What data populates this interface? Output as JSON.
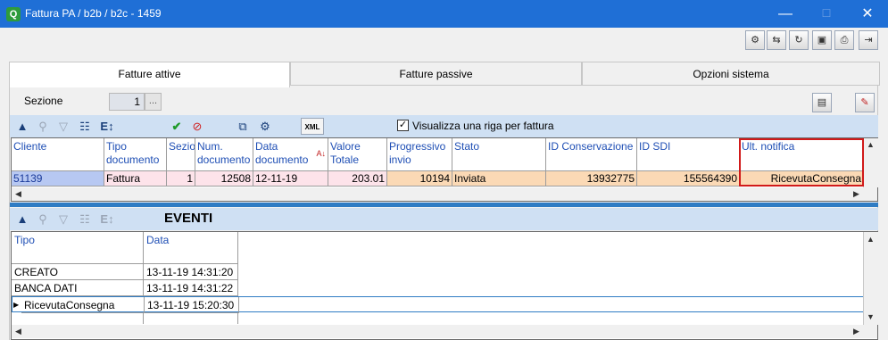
{
  "window": {
    "title": "Fattura PA / b2b / b2c - 1459",
    "app_icon": "Q"
  },
  "window_controls": {
    "minimize": "—",
    "maximize": "☐",
    "close": "✕"
  },
  "toolbar_icons": [
    "tools-icon",
    "transfer-icon",
    "refresh-icon",
    "save-icon",
    "print-icon",
    "exit-icon"
  ],
  "tabs": [
    {
      "label": "Fatture attive",
      "active": true
    },
    {
      "label": "Fatture passive",
      "active": false
    },
    {
      "label": "Opzioni sistema",
      "active": false
    }
  ],
  "sezione": {
    "label": "Sezione",
    "value": "1",
    "browse": "..."
  },
  "grid_toolbar": {
    "checkbox_label": "Visualizza una riga per fattura",
    "checkbox_checked": true,
    "xml_label": "XML"
  },
  "invoices": {
    "columns": [
      "Cliente",
      "Tipo documento",
      "Sezio",
      "Num. documento",
      "Data documento",
      "Valore Totale",
      "Progressivo invio",
      "Stato",
      "ID Conservazione",
      "ID SDI",
      "Ult. notifica"
    ],
    "rows": [
      [
        "51139",
        "Fattura",
        "1",
        "12508",
        "12-11-19",
        "203.01",
        "10194",
        "Inviata",
        "13932775",
        "155564390",
        "RicevutaConsegna"
      ]
    ]
  },
  "events": {
    "title": "EVENTI",
    "columns": [
      "Tipo",
      "Data"
    ],
    "rows": [
      [
        "CREATO",
        "13-11-19 14:31:20"
      ],
      [
        "BANCA DATI",
        "13-11-19 14:31:22"
      ],
      [
        "RicevutaConsegna",
        "13-11-19 15:20:30"
      ]
    ]
  },
  "colors": {
    "titlebar": "#1f6fd6",
    "grid_toolbar": "#cfe0f3",
    "header_text": "#1f4fb5",
    "row_pink": "#fde3ea",
    "row_orange": "#fbd9b5",
    "cell_selected": "#b7c8f2",
    "highlight": "#d11a1a"
  }
}
